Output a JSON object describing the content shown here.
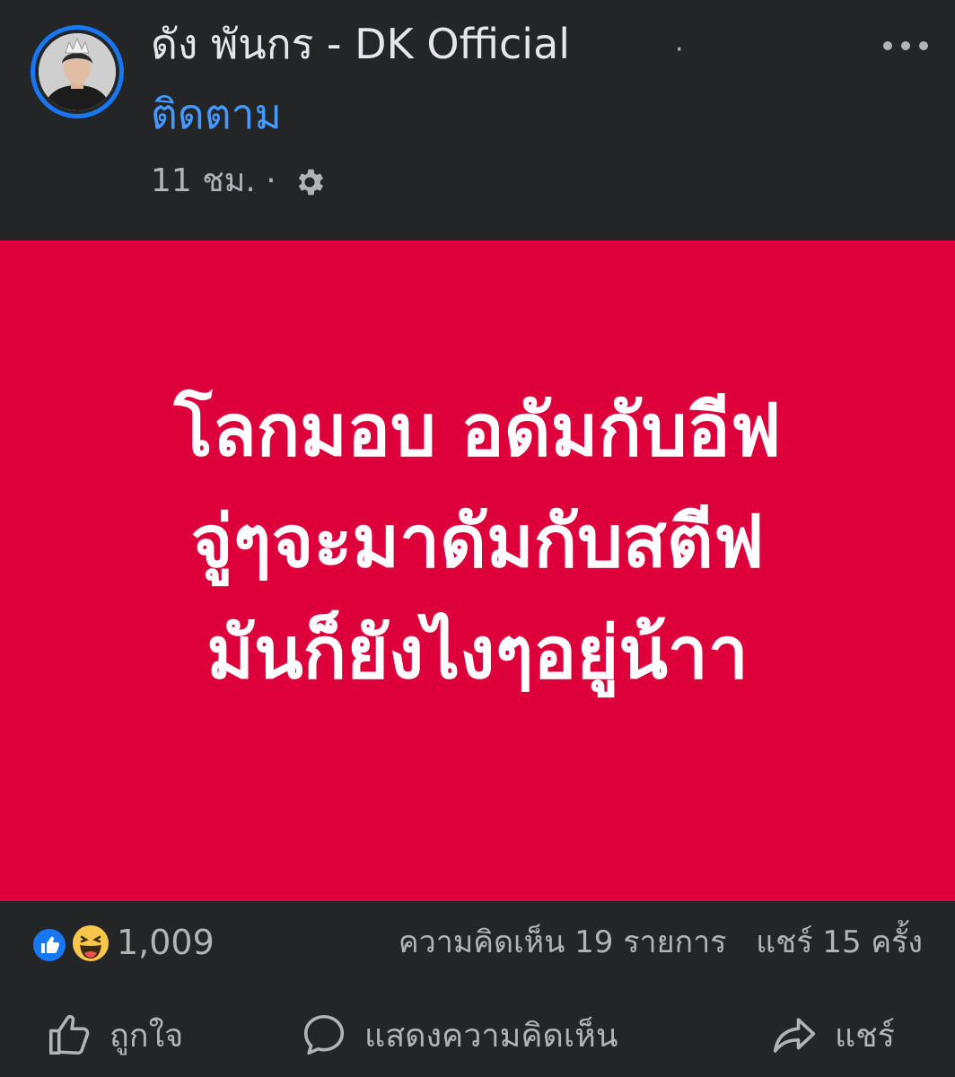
{
  "post": {
    "author": "ดัง พันกร - DK Official",
    "separator": "·",
    "follow_label": "ติดตาม",
    "time": "11 ชม. ·",
    "audience_icon": "gear-icon",
    "more_icon": "more-options-icon"
  },
  "image_text": {
    "lines": [
      "โลกมอบ อดัมกับอีฟ",
      "จู่ๆจะมาดัมกับสตีฟ",
      "มันก็ยังไงๆอยู่น้าา"
    ]
  },
  "stats": {
    "reaction_count": "1,009",
    "comments": "ความคิดเห็น 19 รายการ",
    "shares": "แชร์ 15 ครั้ง"
  },
  "actions": {
    "like_label": "ถูกใจ",
    "comment_label": "แสดงความคิดเห็น",
    "share_label": "แชร์"
  },
  "colors": {
    "background": "#242526",
    "image_background": "#dd003b",
    "accent": "#1877f2",
    "link": "#4599ff",
    "text_primary": "#e4e6eb",
    "text_secondary": "#b0b3b8"
  }
}
